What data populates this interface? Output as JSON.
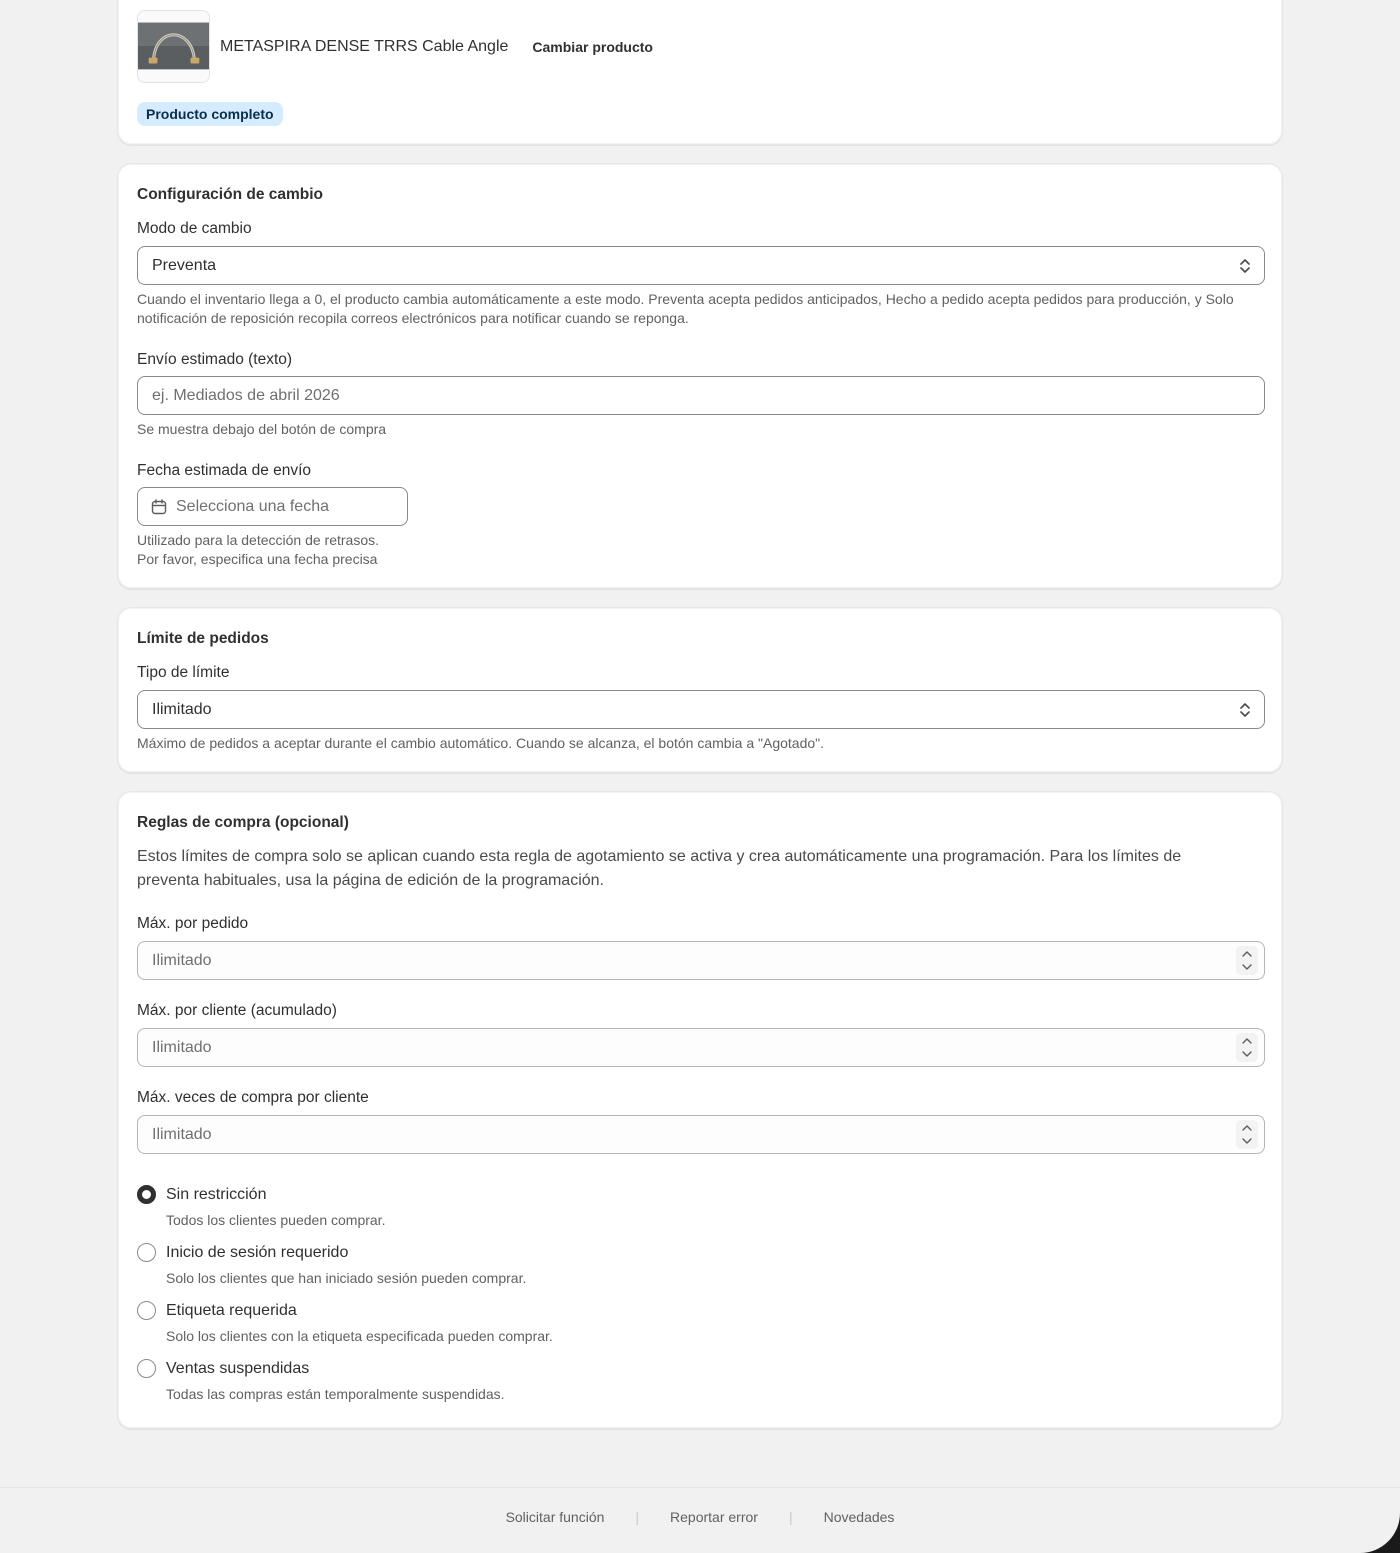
{
  "product": {
    "name": "METASPIRA DENSE TRRS Cable Angle",
    "change_label": "Cambiar producto",
    "badge": "Producto completo"
  },
  "switch_config": {
    "title": "Configuración de cambio",
    "mode_label": "Modo de cambio",
    "mode_value": "Preventa",
    "mode_help": "Cuando el inventario llega a 0, el producto cambia automáticamente a este modo. Preventa acepta pedidos anticipados, Hecho a pedido acepta pedidos para producción, y Solo notificación de reposición recopila correos electrónicos para notificar cuando se reponga.",
    "shipping_text_label": "Envío estimado (texto)",
    "shipping_text_placeholder": "ej. Mediados de abril 2026",
    "shipping_text_help": "Se muestra debajo del botón de compra",
    "shipping_date_label": "Fecha estimada de envío",
    "shipping_date_placeholder": "Selecciona una fecha",
    "shipping_date_help_1": "Utilizado para la detección de retrasos.",
    "shipping_date_help_2": "Por favor, especifica una fecha precisa"
  },
  "order_limit": {
    "title": "Límite de pedidos",
    "type_label": "Tipo de límite",
    "type_value": "Ilimitado",
    "help": "Máximo de pedidos a aceptar durante el cambio automático. Cuando se alcanza, el botón cambia a \"Agotado\"."
  },
  "purchase_rules": {
    "title": "Reglas de compra (opcional)",
    "intro": "Estos límites de compra solo se aplican cuando esta regla de agotamiento se activa y crea automáticamente una programación. Para los límites de preventa habituales, usa la página de edición de la programación.",
    "max_per_order_label": "Máx. por pedido",
    "max_per_order_placeholder": "Ilimitado",
    "max_per_customer_label": "Máx. por cliente (acumulado)",
    "max_per_customer_placeholder": "Ilimitado",
    "max_times_label": "Máx. veces de compra por cliente",
    "max_times_placeholder": "Ilimitado",
    "options": [
      {
        "label": "Sin restricción",
        "help": "Todos los clientes pueden comprar.",
        "checked": true
      },
      {
        "label": "Inicio de sesión requerido",
        "help": "Solo los clientes que han iniciado sesión pueden comprar.",
        "checked": false
      },
      {
        "label": "Etiqueta requerida",
        "help": "Solo los clientes con la etiqueta especificada pueden comprar.",
        "checked": false
      },
      {
        "label": "Ventas suspendidas",
        "help": "Todas las compras están temporalmente suspendidas.",
        "checked": false
      }
    ]
  },
  "footer": {
    "links": [
      "Solicitar función",
      "Reportar error",
      "Novedades"
    ],
    "separator": "|"
  }
}
